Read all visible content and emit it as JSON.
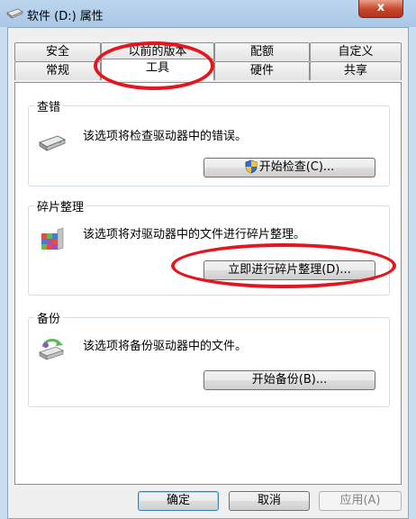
{
  "window": {
    "title": "软件 (D:) 属性",
    "close_label": "x"
  },
  "tabs": {
    "row_back": [
      "安全",
      "以前的版本",
      "配额",
      "自定义"
    ],
    "row_front": [
      "常规",
      "工具",
      "硬件",
      "共享"
    ],
    "active": "工具"
  },
  "groups": [
    {
      "title": "查错",
      "description": "该选项将检查驱动器中的错误。",
      "button": "开始检查(C)...",
      "icon": "drive-icon"
    },
    {
      "title": "碎片整理",
      "description": "该选项将对驱动器中的文件进行碎片整理。",
      "button": "立即进行碎片整理(D)...",
      "icon": "defrag-icon"
    },
    {
      "title": "备份",
      "description": "该选项将备份驱动器中的文件。",
      "button": "开始备份(B)...",
      "icon": "backup-icon"
    }
  ],
  "footer": {
    "ok": "确定",
    "cancel": "取消",
    "apply": "应用(A)"
  },
  "colors": {
    "annotation": "#e8141d",
    "title_bar": "#bcd6ee",
    "close_button": "#c7432a"
  }
}
